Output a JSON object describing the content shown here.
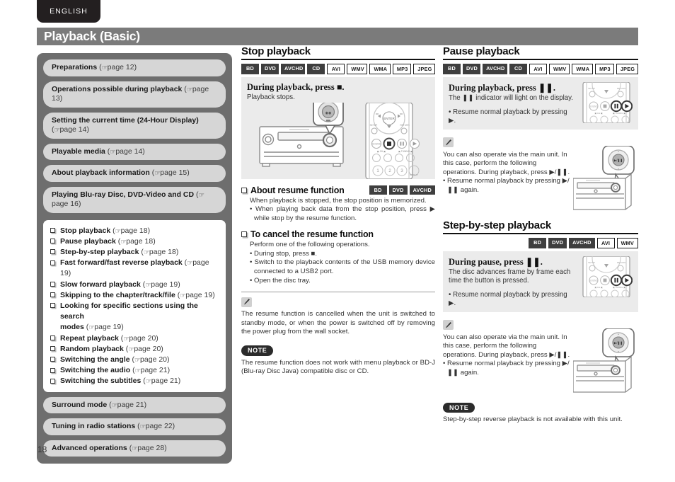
{
  "language_tab": "ENGLISH",
  "page_title": "Playback (Basic)",
  "page_number": "18",
  "sidebar": {
    "items": [
      {
        "label": "Preparations",
        "ref": "page 12"
      },
      {
        "label": "Operations possible during playback",
        "ref": "page 13"
      },
      {
        "label": "Setting the current time (24-Hour Display)",
        "ref": "page 14"
      },
      {
        "label": "Playable media",
        "ref": "page 14"
      },
      {
        "label": "About playback information",
        "ref": "page 15"
      },
      {
        "label": "Playing Blu-ray Disc, DVD-Video and CD",
        "ref": "page 16"
      }
    ],
    "sub_items": [
      {
        "label": "Stop playback",
        "ref": "page 18"
      },
      {
        "label": "Pause playback",
        "ref": "page 18"
      },
      {
        "label": "Step-by-step playback",
        "ref": "page 18"
      },
      {
        "label": "Fast forward/fast reverse playback",
        "ref": "page 19"
      },
      {
        "label": "Slow forward playback",
        "ref": "page 19"
      },
      {
        "label": "Skipping to the chapter/track/file",
        "ref": "page 19"
      },
      {
        "label": "Looking for specific sections using the search",
        "label2": "modes",
        "ref": "page 19"
      },
      {
        "label": "Repeat playback",
        "ref": "page 20"
      },
      {
        "label": "Random playback",
        "ref": "page 20"
      },
      {
        "label": "Switching the angle",
        "ref": "page 20"
      },
      {
        "label": "Switching the audio",
        "ref": "page 21"
      },
      {
        "label": "Switching the subtitles",
        "ref": "page 21"
      }
    ],
    "items_bottom": [
      {
        "label": "Surround mode",
        "ref": "page 21"
      },
      {
        "label": "Tuning in radio stations",
        "ref": "page 22"
      },
      {
        "label": "Advanced operations",
        "ref": "page 28"
      }
    ]
  },
  "stop_playback": {
    "heading": "Stop playback",
    "badges": [
      {
        "text": "BD",
        "style": "dark"
      },
      {
        "text": "DVD",
        "style": "dark"
      },
      {
        "text": "AVCHD",
        "style": "dark"
      },
      {
        "text": "CD",
        "style": "dark"
      },
      {
        "text": "AVI",
        "style": "light"
      },
      {
        "text": "WMV",
        "style": "light"
      },
      {
        "text": "WMA",
        "style": "light"
      },
      {
        "text": "MP3",
        "style": "light"
      },
      {
        "text": "JPEG",
        "style": "light"
      }
    ],
    "instruction_title": "During playback, press ■.",
    "instruction_sub": "Playback stops.",
    "resume": {
      "heading": "About resume function",
      "badges": [
        {
          "text": "BD",
          "style": "dark"
        },
        {
          "text": "DVD",
          "style": "dark"
        },
        {
          "text": "AVCHD",
          "style": "dark"
        }
      ],
      "line1": "When playback is stopped, the stop position is memorized.",
      "bullet1": "• When playing back data from the stop position, press ▶ while stop by the resume function."
    },
    "cancel_resume": {
      "heading": "To cancel the resume function",
      "line1": "Perform one of the following operations.",
      "bullet1": "• During stop, press ■.",
      "bullet2": "• Switch to the playback contents of the USB memory device connected to a USB2 port.",
      "bullet3": "• Open the disc tray."
    },
    "tip_text": "The resume function is cancelled when the unit is switched to standby mode, or when the power is switched off by removing the power plug from the wall socket.",
    "note_label": "NOTE",
    "note_text": "The resume function does not work with menu playback or BD-J (Blu-ray Disc Java) compatible disc or CD."
  },
  "pause_playback": {
    "heading": "Pause playback",
    "badges": [
      {
        "text": "BD",
        "style": "dark"
      },
      {
        "text": "DVD",
        "style": "dark"
      },
      {
        "text": "AVCHD",
        "style": "dark"
      },
      {
        "text": "CD",
        "style": "dark"
      },
      {
        "text": "AVI",
        "style": "light"
      },
      {
        "text": "WMV",
        "style": "light"
      },
      {
        "text": "WMA",
        "style": "light"
      },
      {
        "text": "MP3",
        "style": "light"
      },
      {
        "text": "JPEG",
        "style": "light"
      }
    ],
    "instruction_title": "During playback, press ❚❚.",
    "instruction_sub": "The ❚❚ indicator will light on the display.",
    "instruction_bullet": "• Resume normal playback by pressing ▶.",
    "tip_line1": "You can also operate via the main unit. In this",
    "tip_line2": "case, perform the following operations.",
    "tip_line3": "During playback, press ▶/❚❚.",
    "tip_bullet": "• Resume normal playback by pressing ▶/❚❚ again."
  },
  "step_playback": {
    "heading": "Step-by-step playback",
    "badges": [
      {
        "text": "BD",
        "style": "dark"
      },
      {
        "text": "DVD",
        "style": "dark"
      },
      {
        "text": "AVCHD",
        "style": "dark"
      },
      {
        "text": "AVI",
        "style": "light"
      },
      {
        "text": "WMV",
        "style": "light"
      }
    ],
    "instruction_title": "During pause, press ❚❚.",
    "instruction_sub": "The disc advances frame by frame each time the button is pressed.",
    "instruction_bullet": "• Resume normal playback by pressing ▶.",
    "tip_line1": "You can also operate via the main unit. In this",
    "tip_line2": "case, perform the following operations.",
    "tip_line3": "During playback, press ▶/❚❚.",
    "tip_bullet": "• Resume normal playback by pressing ▶/❚❚ again.",
    "note_label": "NOTE",
    "note_text": "Step-by-step reverse playback is not available with this unit."
  },
  "colors": {
    "title_bar": "#7b7b7b",
    "nav_panel": "#6e6e6e",
    "nav_pill": "#d6d6d6",
    "badge_dark": "#3e3e3e",
    "instr_box": "#ebebeb",
    "tab_dark": "#231f20"
  }
}
